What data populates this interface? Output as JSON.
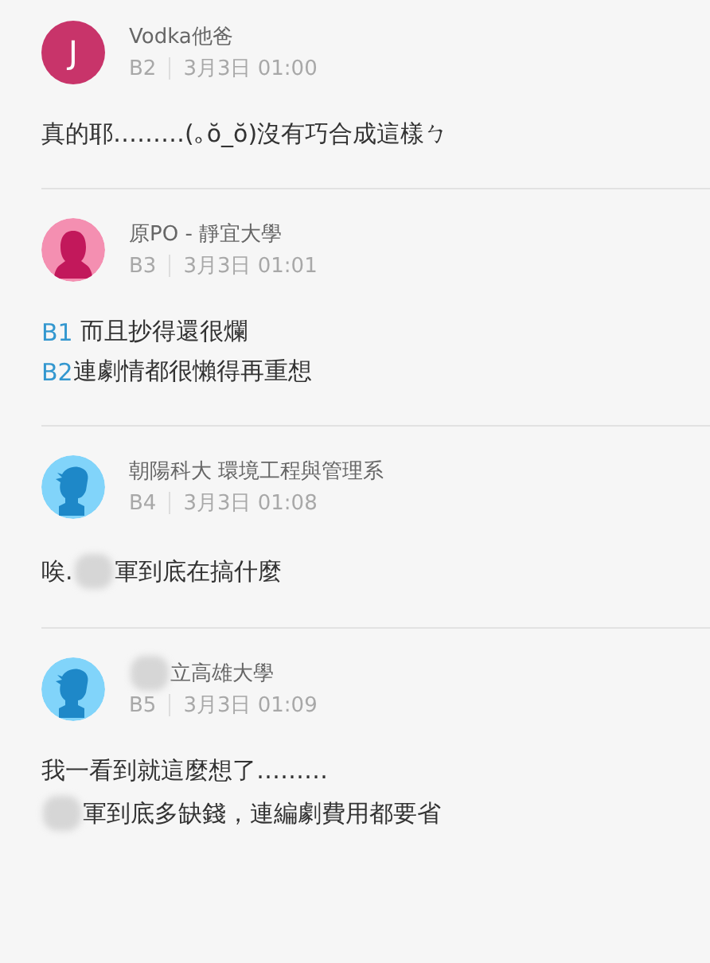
{
  "comments": [
    {
      "avatar": {
        "kind": "letter",
        "letter": "J"
      },
      "author": [
        {
          "kind": "text",
          "text": "Vodka他爸"
        }
      ],
      "floor": "B2",
      "time": "3月3日 01:00",
      "lines": [
        [
          {
            "kind": "text",
            "text": "真的耶………(｡ŏ_ŏ)沒有巧合成這樣ㄅ"
          }
        ]
      ]
    },
    {
      "avatar": {
        "kind": "female"
      },
      "author": [
        {
          "kind": "text",
          "text": "原PO - 靜宜大學"
        }
      ],
      "floor": "B3",
      "time": "3月3日 01:01",
      "lines": [
        [
          {
            "kind": "mention",
            "text": "B1"
          },
          {
            "kind": "text",
            "text": " 而且抄得還很爛"
          }
        ],
        [
          {
            "kind": "mention",
            "text": "B2"
          },
          {
            "kind": "text",
            "text": "連劇情都很懶得再重想"
          }
        ]
      ]
    },
    {
      "avatar": {
        "kind": "male"
      },
      "author": [
        {
          "kind": "text",
          "text": "朝陽科大 環境工程與管理系"
        }
      ],
      "floor": "B4",
      "time": "3月3日 01:08",
      "lines": [
        [
          {
            "kind": "text",
            "text": "唉."
          },
          {
            "kind": "redaction"
          },
          {
            "kind": "text",
            "text": "軍到底在搞什麼"
          }
        ]
      ]
    },
    {
      "avatar": {
        "kind": "male"
      },
      "author": [
        {
          "kind": "redaction"
        },
        {
          "kind": "text",
          "text": "立高雄大學"
        }
      ],
      "floor": "B5",
      "time": "3月3日 01:09",
      "lines": [
        [
          {
            "kind": "text",
            "text": "我一看到就這麼想了………"
          }
        ],
        [
          {
            "kind": "redaction"
          },
          {
            "kind": "text",
            "text": "軍到底多缺錢，連編劇費用都要省"
          }
        ]
      ]
    }
  ]
}
